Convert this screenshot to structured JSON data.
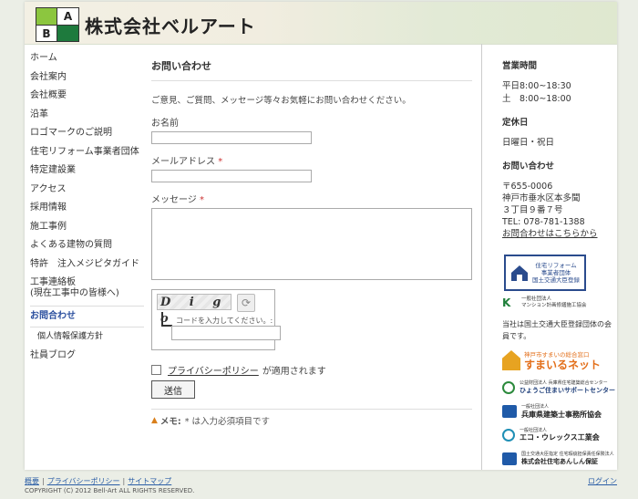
{
  "header": {
    "logo_letters": [
      "",
      "A",
      "B",
      ""
    ],
    "site_title": "株式会社ベルアート"
  },
  "nav": {
    "items": [
      {
        "label": "ホーム"
      },
      {
        "label": "会社案内"
      },
      {
        "label": "会社概要"
      },
      {
        "label": "沿革"
      },
      {
        "label": "ロゴマークのご説明"
      },
      {
        "label": "住宅リフォーム事業者団体"
      },
      {
        "label": "特定建設業"
      },
      {
        "label": "アクセス"
      },
      {
        "label": "採用情報"
      },
      {
        "label": "施工事例"
      },
      {
        "label": "よくある建物の質問"
      },
      {
        "label": "特許　注入メジピタガイド"
      }
    ],
    "multi_item": {
      "line1": "工事連絡板",
      "line2": "(現在工事中の皆様へ)"
    },
    "active_item": "お問合わせ",
    "sub_item": "個人情報保護方針",
    "last_item": "社員ブログ"
  },
  "form": {
    "title": "お問い合わせ",
    "intro": "ご意見、ご質問、メッセージ等々お気軽にお問い合わせください。",
    "name_label": "お名前",
    "email_label": "メールアドレス",
    "message_label": "メッセージ",
    "required_mark": "*",
    "captcha_text": "D   i   g   o",
    "captcha_hint": "コードを入力してください。:",
    "privacy_link": "プライバシーポリシー",
    "privacy_suffix": "が適用されます",
    "submit_label": "送信",
    "memo_label": "メモ:",
    "memo_text": "* は入力必須項目です"
  },
  "sidebar": {
    "hours_title": "営業時間",
    "weekday": "平日8:00~18:30",
    "saturday": "土　8:00~18:00",
    "holiday_title": "定休日",
    "holiday": "日曜日・祝日",
    "contact_title": "お問い合わせ",
    "postal": "〒655-0006",
    "address1": "神戸市垂水区本多聞",
    "address2": "３丁目９番７号",
    "tel": "TEL: 078-781-1388",
    "contact_link": "お問合わせはこちらから",
    "reform_badge_line1": "住宅リフォーム",
    "reform_badge_line2": "事業者団体",
    "reform_badge_line3": "国土交通大臣登録",
    "mks_small": "一般社団法人",
    "mks_name": "マンション計画修繕施工協会",
    "note": "当社は国土交通大臣登録団体の会員です。",
    "sumairu_top": "神戸市すまいの総合窓口",
    "sumairu_main": "すまいるネット",
    "hyogo_small": "公益財団法人 兵庫県住宅建築総合センター",
    "hyogo_name": "ひょうご住まいサポートセンター",
    "kenchiku_small": "一般社団法人",
    "kenchiku_name": "兵庫県建築士事務所協会",
    "eco_small": "一般社団法人",
    "eco_name": "エコ・ウレックス工業会",
    "anshin_small": "国土交通大臣指定 住宅瑕疵担保責任保険法人",
    "anshin_name": "株式会社住宅あんしん保証"
  },
  "footer": {
    "links": [
      "概要",
      "プライバシーポリシー",
      "サイトマップ"
    ],
    "copyright": "COPYRIGHT (C) 2012 Bell-Art ALL RIGHTS RESERVED.",
    "login": "ログイン"
  },
  "colors": {
    "accent_link": "#2b5ea6",
    "logo_light_green": "#8cc63f",
    "logo_dark_green": "#1e7a3d",
    "required": "#cc3333"
  }
}
